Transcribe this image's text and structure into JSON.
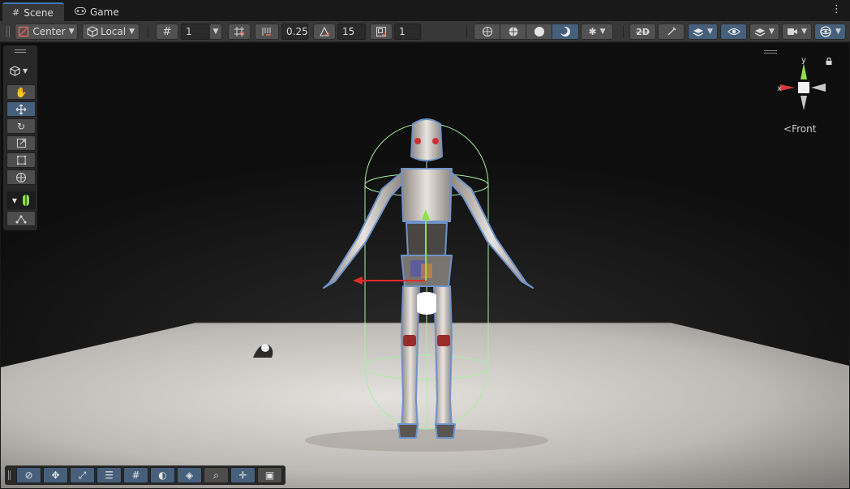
{
  "tabs": [
    {
      "label": "Scene",
      "icon": "grid-icon",
      "active": true
    },
    {
      "label": "Game",
      "icon": "gamepad-icon",
      "active": false
    }
  ],
  "toolbar": {
    "pivot_label": "Center",
    "space_label": "Local",
    "grid_size": "1",
    "snap_increment": "0.25",
    "rotate_snap": "15",
    "scale_snap": "1"
  },
  "orientation": {
    "view_label": "Front",
    "axis_x": "x",
    "axis_y": "y"
  },
  "colors": {
    "accent": "#46607c",
    "active_tab_border": "#3a79bb",
    "axis_x": "#d43a3a",
    "axis_y": "#8ce04a",
    "collider": "#a6f0a0"
  }
}
